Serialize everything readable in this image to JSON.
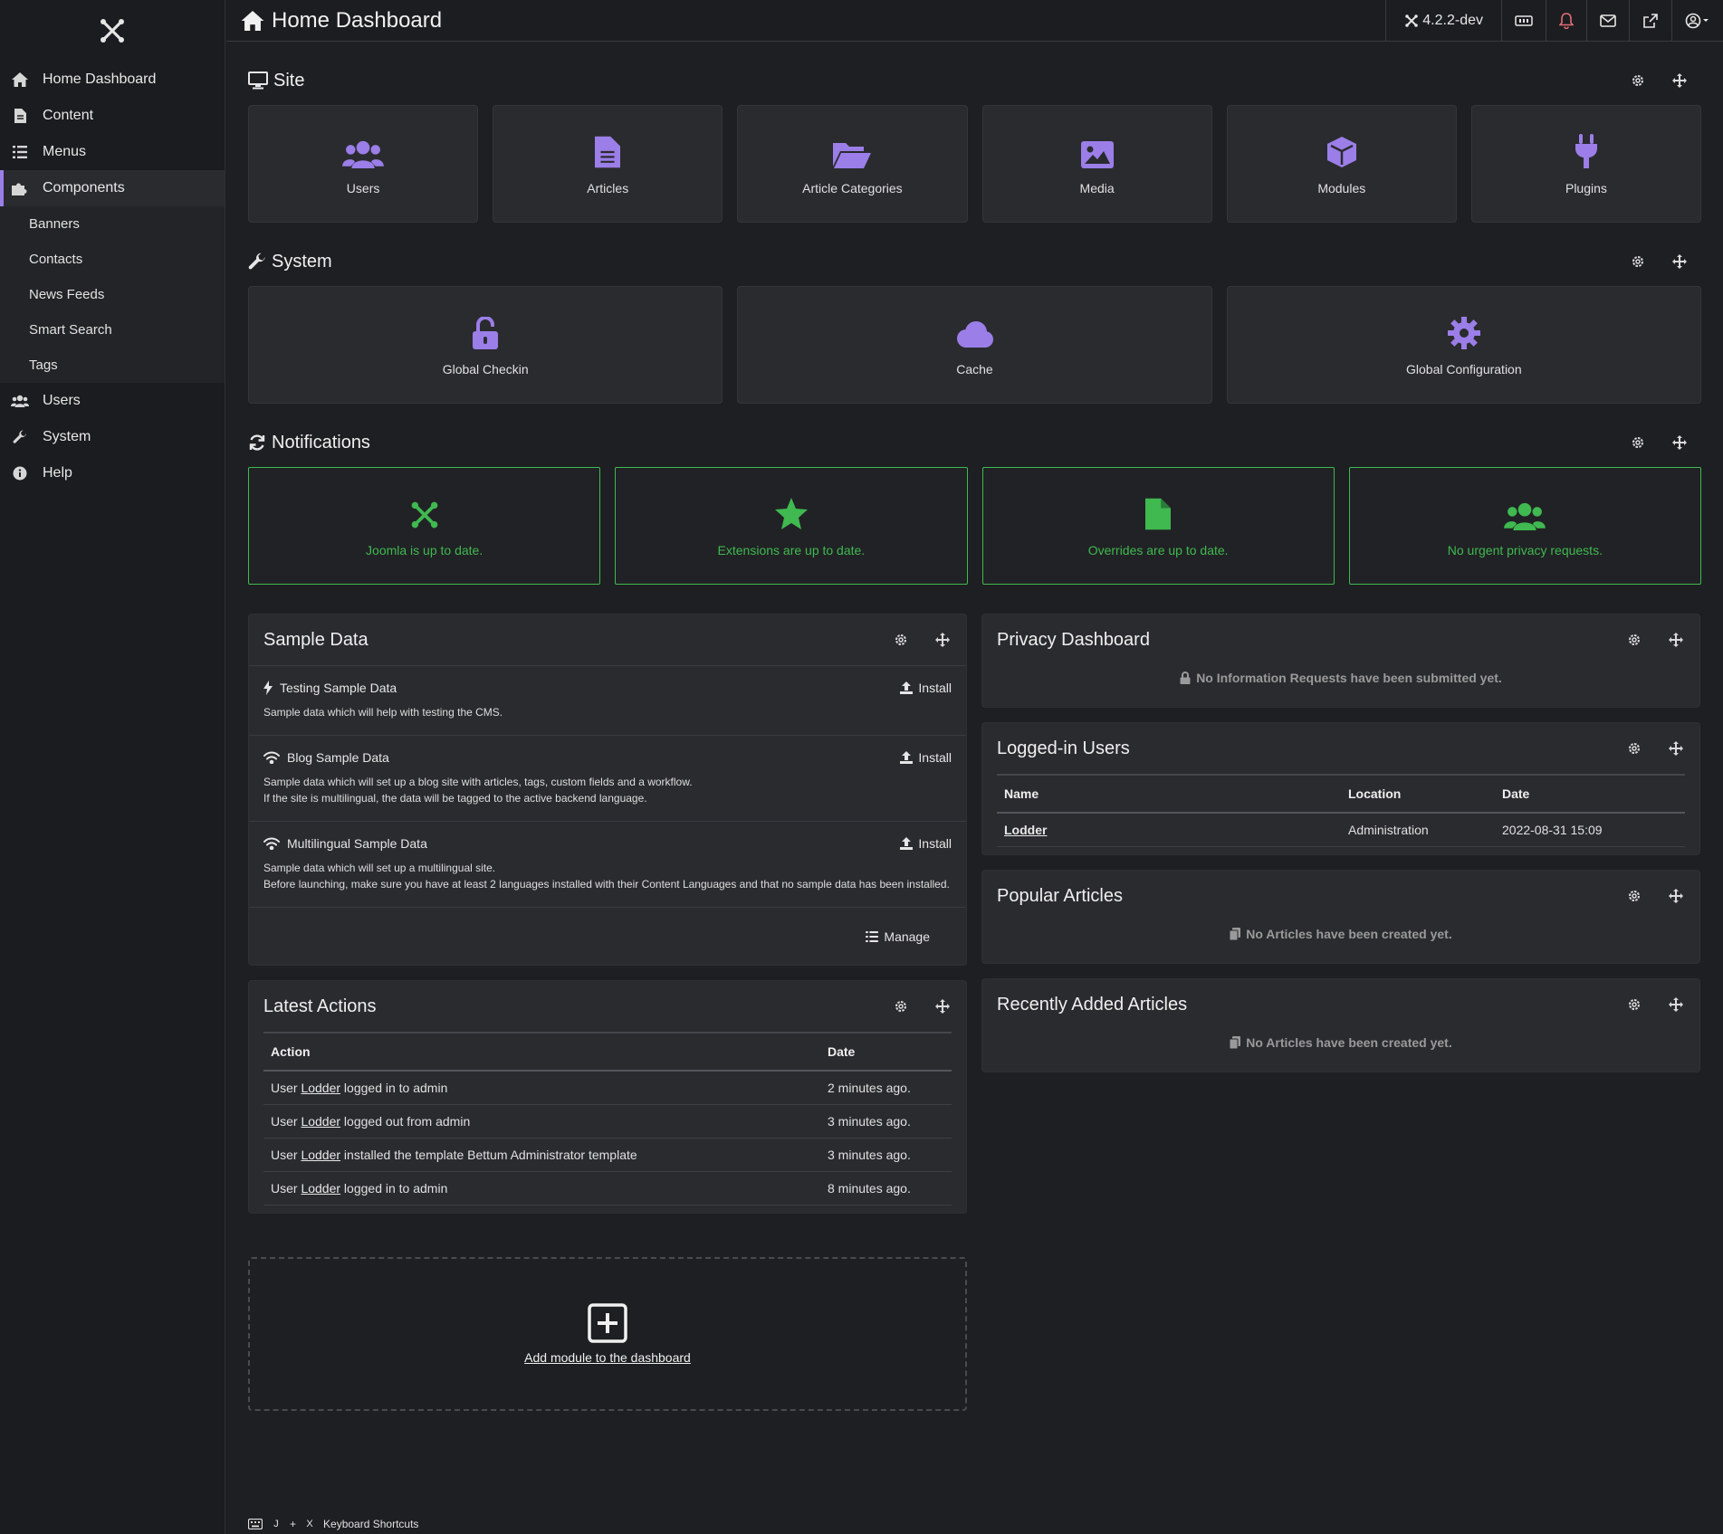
{
  "sidebar": {
    "logo_icon": "joomla-icon",
    "items": [
      {
        "label": "Home Dashboard",
        "icon": "home-icon"
      },
      {
        "label": "Content",
        "icon": "file-icon"
      },
      {
        "label": "Menus",
        "icon": "list-icon"
      },
      {
        "label": "Components",
        "icon": "puzzle-icon",
        "active": true
      },
      {
        "label": "Users",
        "icon": "users-icon"
      },
      {
        "label": "System",
        "icon": "wrench-icon"
      },
      {
        "label": "Help",
        "icon": "info-icon"
      }
    ],
    "sub_items": [
      "Banners",
      "Contacts",
      "News Feeds",
      "Smart Search",
      "Tags"
    ],
    "accent": "#9b7ee8"
  },
  "header": {
    "title": "Home Dashboard",
    "version": "4.2.2-dev",
    "icons": [
      "accessibility-icon",
      "bell-icon",
      "mail-icon",
      "external-link-icon",
      "user-menu-icon"
    ],
    "bell_color": "#e06c75"
  },
  "site": {
    "title": "Site",
    "tiles": [
      {
        "label": "Users",
        "icon": "users-icon"
      },
      {
        "label": "Articles",
        "icon": "file-icon"
      },
      {
        "label": "Article Categories",
        "icon": "folder-open-icon"
      },
      {
        "label": "Media",
        "icon": "image-icon"
      },
      {
        "label": "Modules",
        "icon": "cube-icon"
      },
      {
        "label": "Plugins",
        "icon": "plug-icon"
      }
    ]
  },
  "system": {
    "title": "System",
    "tiles": [
      {
        "label": "Global Checkin",
        "icon": "unlock-icon"
      },
      {
        "label": "Cache",
        "icon": "cloud-icon"
      },
      {
        "label": "Global Configuration",
        "icon": "cog-icon"
      }
    ]
  },
  "notifications": {
    "title": "Notifications",
    "color": "#3fb950",
    "items": [
      {
        "label": "Joomla is up to date.",
        "icon": "joomla-icon"
      },
      {
        "label": "Extensions are up to date.",
        "icon": "star-icon"
      },
      {
        "label": "Overrides are up to date.",
        "icon": "file-icon"
      },
      {
        "label": "No urgent privacy requests.",
        "icon": "users-icon"
      }
    ]
  },
  "sample_data": {
    "title": "Sample Data",
    "items": [
      {
        "name": "Testing Sample Data",
        "icon": "bolt-icon",
        "action": "Install",
        "desc": [
          "Sample data which will help with testing the CMS."
        ]
      },
      {
        "name": "Blog Sample Data",
        "icon": "wifi-icon",
        "action": "Install",
        "desc": [
          "Sample data which will set up a blog site with articles, tags, custom fields and a workflow.",
          "If the site is multilingual, the data will be tagged to the active backend language."
        ]
      },
      {
        "name": "Multilingual Sample Data",
        "icon": "wifi-icon",
        "action": "Install",
        "desc": [
          "Sample data which will set up a multilingual site.",
          "Before launching, make sure you have at least 2 languages installed with their Content Languages and that no sample data has been installed."
        ]
      }
    ],
    "manage": "Manage"
  },
  "latest_actions": {
    "title": "Latest Actions",
    "headers": [
      "Action",
      "Date"
    ],
    "rows": [
      {
        "pre": "User ",
        "user": "Lodder",
        "post": " logged in to admin",
        "date": "2 minutes ago."
      },
      {
        "pre": "User ",
        "user": "Lodder",
        "post": " logged out from admin",
        "date": "3 minutes ago."
      },
      {
        "pre": "User ",
        "user": "Lodder",
        "post": " installed the template Bettum Administrator template",
        "date": "3 minutes ago."
      },
      {
        "pre": "User ",
        "user": "Lodder",
        "post": " logged in to admin",
        "date": "8 minutes ago."
      }
    ]
  },
  "privacy": {
    "title": "Privacy Dashboard",
    "message": "No Information Requests have been submitted yet."
  },
  "logged_in": {
    "title": "Logged-in Users",
    "headers": [
      "Name",
      "Location",
      "Date"
    ],
    "rows": [
      {
        "name": "Lodder",
        "location": "Administration",
        "date": "2022-08-31 15:09"
      }
    ]
  },
  "popular": {
    "title": "Popular Articles",
    "message": "No Articles have been created yet."
  },
  "recent": {
    "title": "Recently Added Articles",
    "message": "No Articles have been created yet."
  },
  "add_module": {
    "label": "Add module to the dashboard"
  },
  "shortcuts": {
    "key1": "J",
    "plus": "+",
    "key2": "X",
    "label": "Keyboard Shortcuts"
  }
}
